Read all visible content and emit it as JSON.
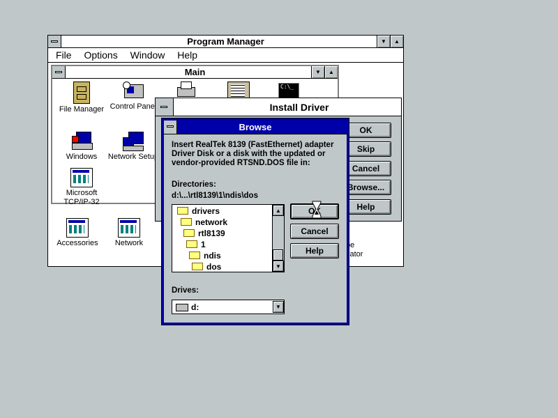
{
  "program_manager": {
    "title": "Program Manager",
    "menu": [
      "File",
      "Options",
      "Window",
      "Help"
    ],
    "min_icon": "▼",
    "max_icon": "▲"
  },
  "main_group": {
    "title": "Main",
    "icons": [
      {
        "label": "File Manager",
        "icon": "file-cabinet-icon"
      },
      {
        "label": "Control Panel",
        "icon": "control-panel-icon"
      },
      {
        "label": "Windows",
        "icon": "windows-setup-icon"
      },
      {
        "label": "Network Setup",
        "icon": "network-setup-icon"
      },
      {
        "label": "Microsoft TCP/IP-32",
        "icon": "tcpip-icon"
      }
    ]
  },
  "bottom_groups": [
    {
      "label": "Accessories"
    },
    {
      "label": "Network"
    }
  ],
  "partial_labels": {
    "l1": "be",
    "l2": "cator"
  },
  "install_driver": {
    "title": "Install Driver",
    "buttons": [
      "OK",
      "Skip",
      "Cancel",
      "Browse...",
      "Help"
    ]
  },
  "browse": {
    "title": "Browse",
    "message": "Insert  RealTek 8139 (FastEthernet) adapter Driver Disk or a disk with the updated or vendor-provided RTSND.DOS file in:",
    "directories_label": "Directories:",
    "current_path": "d:\\...\\rtl8139\\1\\ndis\\dos",
    "dirs": [
      "drivers",
      "network",
      "rtl8139",
      "1",
      "ndis",
      "dos"
    ],
    "buttons": {
      "ok": "OK",
      "cancel": "Cancel",
      "help": "Help"
    },
    "drives_label": "Drives:",
    "drive": "d:"
  },
  "colors": {
    "desktop": "#c0c7c8",
    "active_title": "#0000a8",
    "folder": "#ffff80"
  }
}
